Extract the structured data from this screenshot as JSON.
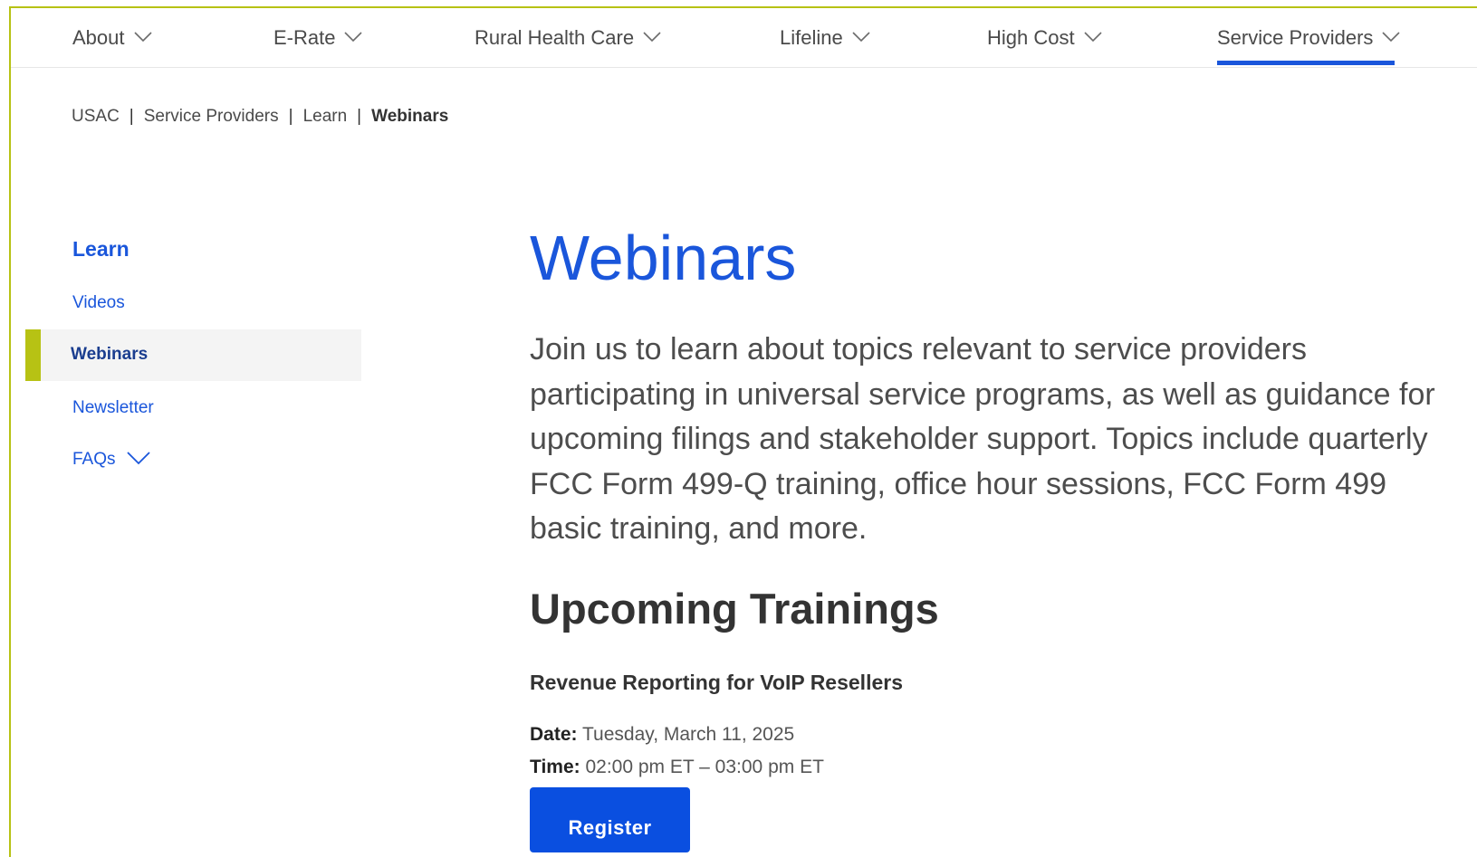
{
  "nav": {
    "items": [
      {
        "label": "About"
      },
      {
        "label": "E-Rate"
      },
      {
        "label": "Rural Health Care"
      },
      {
        "label": "Lifeline"
      },
      {
        "label": "High Cost"
      },
      {
        "label": "Service Providers",
        "active": true
      }
    ]
  },
  "breadcrumb": {
    "items": [
      "USAC",
      "Service Providers",
      "Learn"
    ],
    "current": "Webinars",
    "separator": "|"
  },
  "sidebar": {
    "title": "Learn",
    "items": [
      {
        "label": "Videos"
      },
      {
        "label": "Webinars",
        "active": true
      },
      {
        "label": "Newsletter"
      },
      {
        "label": "FAQs"
      }
    ]
  },
  "main": {
    "title": "Webinars",
    "intro": "Join us to learn about topics relevant to service providers participating in universal service programs, as well as guidance for upcoming filings and stakeholder support. Topics include quarterly FCC Form 499-Q training, office hour sessions, FCC Form 499 basic training, and more.",
    "section_title": "Upcoming Trainings",
    "training": {
      "title": "Revenue Reporting for VoIP Resellers",
      "date_label": "Date:",
      "date_value": "Tuesday, March 11, 2025",
      "time_label": "Time:",
      "time_value": "02:00 pm ET – 03:00 pm ET",
      "register_label": "Register"
    }
  },
  "colors": {
    "accent": "#1a56db",
    "highlight_bar": "#b7c214",
    "button": "#0a4fe0"
  }
}
